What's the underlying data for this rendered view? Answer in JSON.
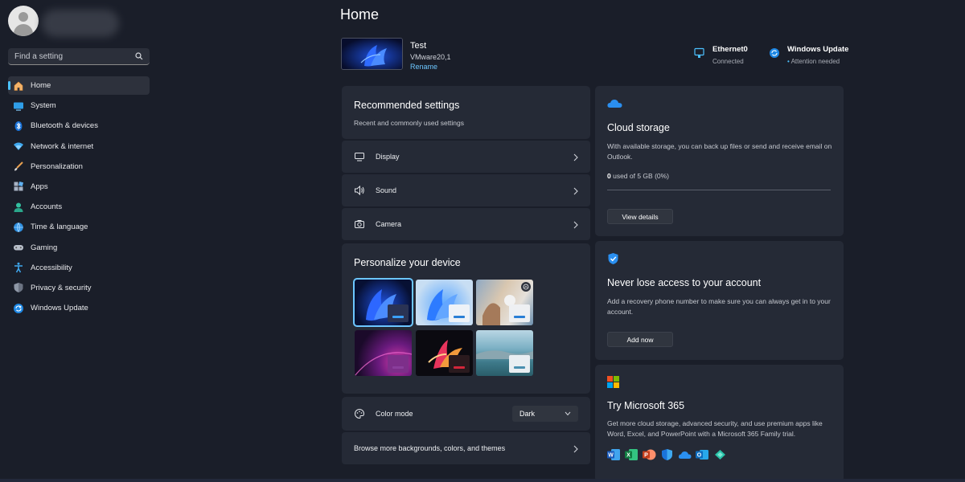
{
  "search": {
    "placeholder": "Find a setting"
  },
  "sidebar": {
    "items": [
      {
        "label": "Home",
        "icon": "home-icon",
        "active": true
      },
      {
        "label": "System",
        "icon": "system-icon"
      },
      {
        "label": "Bluetooth & devices",
        "icon": "bluetooth-icon"
      },
      {
        "label": "Network & internet",
        "icon": "network-icon"
      },
      {
        "label": "Personalization",
        "icon": "brush-icon"
      },
      {
        "label": "Apps",
        "icon": "apps-icon"
      },
      {
        "label": "Accounts",
        "icon": "accounts-icon"
      },
      {
        "label": "Time & language",
        "icon": "time-language-icon"
      },
      {
        "label": "Gaming",
        "icon": "gaming-icon"
      },
      {
        "label": "Accessibility",
        "icon": "accessibility-icon"
      },
      {
        "label": "Privacy & security",
        "icon": "shield-icon"
      },
      {
        "label": "Windows Update",
        "icon": "windows-update-icon"
      }
    ]
  },
  "main": {
    "title": "Home",
    "device": {
      "name": "Test",
      "model": "VMware20,1",
      "rename": "Rename"
    },
    "status": {
      "ethernet": {
        "title": "Ethernet0",
        "sub": "Connected"
      },
      "update": {
        "title": "Windows Update",
        "sub": "Attention needed"
      }
    },
    "recommended": {
      "title": "Recommended settings",
      "subtitle": "Recent and commonly used settings",
      "items": [
        {
          "label": "Display",
          "icon": "display-icon"
        },
        {
          "label": "Sound",
          "icon": "sound-icon"
        },
        {
          "label": "Camera",
          "icon": "camera-icon"
        }
      ]
    },
    "personalize": {
      "title": "Personalize your device",
      "color_mode_label": "Color mode",
      "color_mode_value": "Dark",
      "browse_label": "Browse more backgrounds, colors, and themes"
    },
    "cloud": {
      "title": "Cloud storage",
      "desc": "With available storage, you can back up files or send and receive email on Outlook.",
      "used_value": "0",
      "used_rest": " used of 5 GB (0%)",
      "used_percent": 0,
      "button": "View details"
    },
    "account": {
      "title": "Never lose access to your account",
      "desc": "Add a recovery phone number to make sure you can always get in to your account.",
      "button": "Add now"
    },
    "m365": {
      "title": "Try Microsoft 365",
      "desc": "Get more cloud storage, advanced security, and use premium apps like Word, Excel, and PowerPoint with a Microsoft 365 Family trial.",
      "apps": [
        "word-icon",
        "excel-icon",
        "powerpoint-icon",
        "defender-icon",
        "onedrive-icon",
        "outlook-icon",
        "clipchamp-icon"
      ]
    }
  },
  "colors": {
    "background": "#1a1e29",
    "card": "#252a36",
    "accent": "#4cc2ff"
  }
}
